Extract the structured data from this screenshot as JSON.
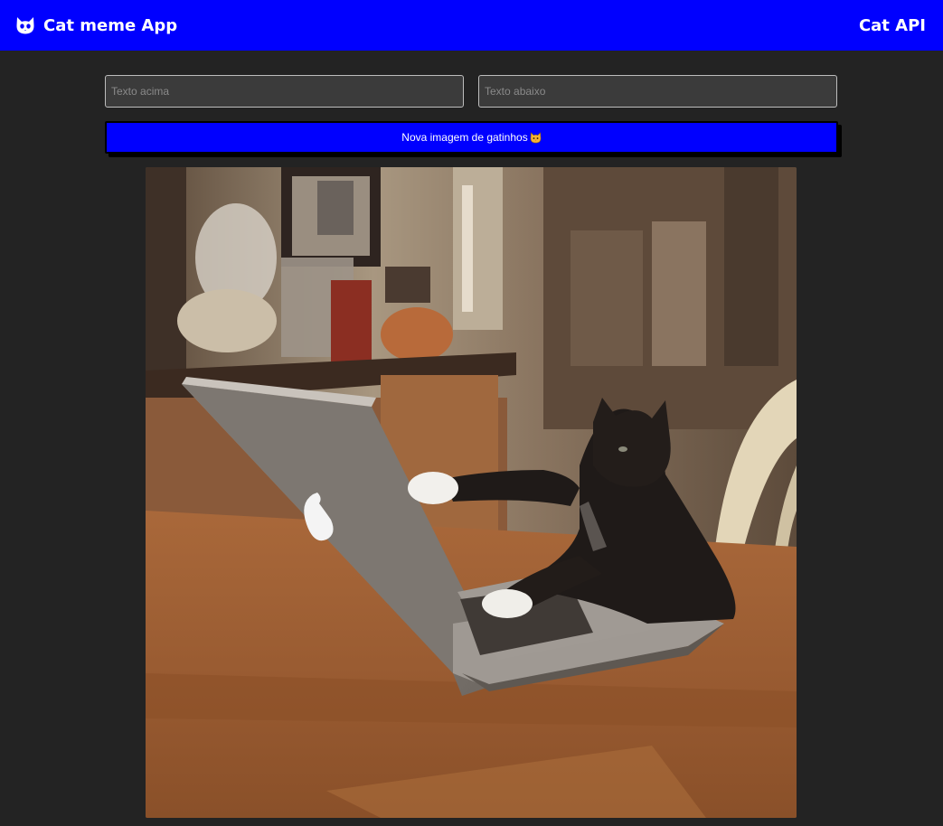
{
  "navbar": {
    "title": "Cat meme App",
    "brand_icon": "cat-face-icon",
    "link_label": "Cat API",
    "color": "#0000ff"
  },
  "form": {
    "top_text_placeholder": "Texto acima",
    "top_text_value": "",
    "bottom_text_placeholder": "Texto abaixo",
    "bottom_text_value": ""
  },
  "button": {
    "label": "Nova imagem de gatinhos",
    "icon": "cat-face-emoji"
  },
  "image": {
    "subject": "cat typing on laptop"
  },
  "colors": {
    "accent": "#0000ff",
    "background": "#232323"
  }
}
